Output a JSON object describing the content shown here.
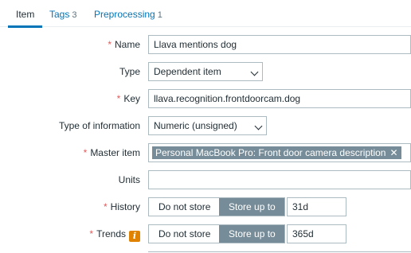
{
  "tabs": [
    {
      "label": "Item",
      "count": ""
    },
    {
      "label": "Tags",
      "count": "3"
    },
    {
      "label": "Preprocessing",
      "count": "1"
    }
  ],
  "form": {
    "name": {
      "label": "Name",
      "value": "Llava mentions dog"
    },
    "type": {
      "label": "Type",
      "value": "Dependent item"
    },
    "key": {
      "label": "Key",
      "value": "llava.recognition.frontdoorcam.dog"
    },
    "type_of_information": {
      "label": "Type of information",
      "value": "Numeric (unsigned)"
    },
    "master_item": {
      "label": "Master item",
      "tag": "Personal MacBook Pro: Front door camera description",
      "remove": "✕"
    },
    "units": {
      "label": "Units",
      "value": ""
    },
    "history": {
      "label": "History",
      "options": [
        "Do not store",
        "Store up to"
      ],
      "selected": "Store up to",
      "value": "31d"
    },
    "trends": {
      "label": "Trends",
      "info": "i",
      "options": [
        "Do not store",
        "Store up to"
      ],
      "selected": "Store up to",
      "value": "365d"
    }
  },
  "required_mark": "*",
  "colors": {
    "accent": "#0275b8",
    "required": "#e45959",
    "selected": "#768d99",
    "warning": "#e08200"
  }
}
